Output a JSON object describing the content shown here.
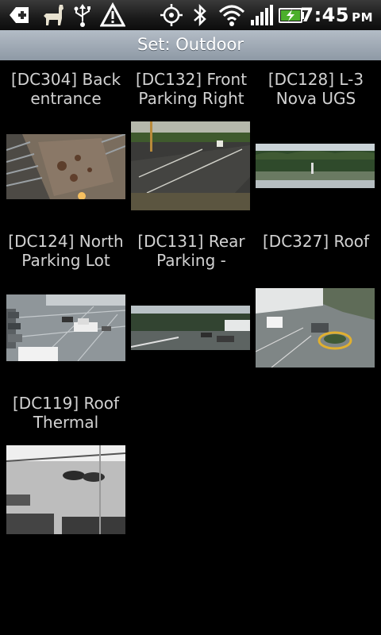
{
  "status_bar": {
    "time": "7:45",
    "ampm": "PM",
    "icons": [
      "notification-plus-icon",
      "llama-icon",
      "usb-icon",
      "warning-icon",
      "gps-icon",
      "bluetooth-icon",
      "wifi-icon",
      "signal-icon",
      "battery-charging-icon"
    ]
  },
  "title_bar": {
    "title": "Set: Outdoor"
  },
  "cameras": [
    {
      "label_line1": "[DC304] Back",
      "label_line2": "entrance"
    },
    {
      "label_line1": "[DC132] Front",
      "label_line2": "Parking Right"
    },
    {
      "label_line1": "[DC128] L-3",
      "label_line2": "Nova UGS"
    },
    {
      "label_line1": "[DC124] North",
      "label_line2": "Parking Lot"
    },
    {
      "label_line1": "[DC131] Rear",
      "label_line2": "Parking -"
    },
    {
      "label_line1": "[DC327] Roof",
      "label_line2": ""
    },
    {
      "label_line1": "[DC119] Roof",
      "label_line2": "Thermal"
    }
  ]
}
